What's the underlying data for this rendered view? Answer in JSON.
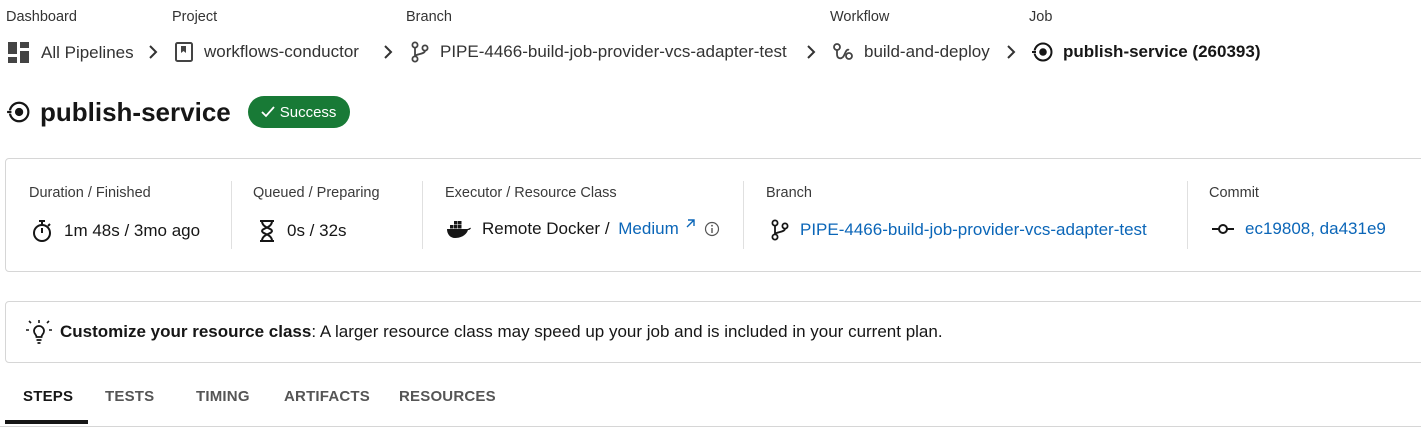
{
  "breadcrumb": {
    "dashboard": {
      "label": "Dashboard",
      "value": "All Pipelines"
    },
    "project": {
      "label": "Project",
      "value": "workflows-conductor"
    },
    "branch": {
      "label": "Branch",
      "value": "PIPE-4466-build-job-provider-vcs-adapter-test"
    },
    "workflow": {
      "label": "Workflow",
      "value": "build-and-deploy"
    },
    "job": {
      "label": "Job",
      "value": "publish-service (260393)"
    }
  },
  "job": {
    "title": "publish-service",
    "status": "Success",
    "status_color": "#187a36"
  },
  "details": {
    "duration": {
      "label": "Duration / Finished",
      "value": "1m 48s / 3mo ago"
    },
    "queued": {
      "label": "Queued / Preparing",
      "value": "0s / 32s"
    },
    "executor": {
      "label": "Executor / Resource Class",
      "executor": "Remote Docker / ",
      "resource_class": "Medium"
    },
    "branch": {
      "label": "Branch",
      "value": "PIPE-4466-build-job-provider-vcs-adapter-test"
    },
    "commit": {
      "label": "Commit",
      "value": "ec19808, da431e9"
    }
  },
  "banner": {
    "title": "Customize your resource class",
    "text": ": A larger resource class may speed up your job and is included in your current plan."
  },
  "tabs": [
    {
      "label": "STEPS",
      "active": true
    },
    {
      "label": "TESTS"
    },
    {
      "label": "TIMING"
    },
    {
      "label": "ARTIFACTS"
    },
    {
      "label": "RESOURCES"
    }
  ],
  "colors": {
    "link": "#0b66b8",
    "text": "#161616",
    "success": "#187a36"
  }
}
